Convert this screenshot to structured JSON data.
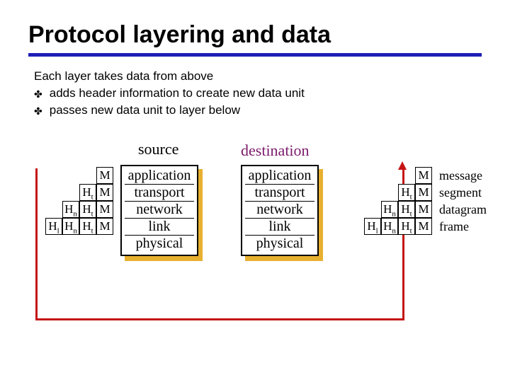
{
  "title": "Protocol layering and data",
  "intro": "Each layer takes data from above",
  "bullets": [
    "adds header information to create new data unit",
    "passes new data unit to layer below"
  ],
  "stack_labels": {
    "source": "source",
    "destination": "destination"
  },
  "layers": [
    "application",
    "transport",
    "network",
    "link",
    "physical"
  ],
  "headers": {
    "Ht": "Ht",
    "Hn": "Hn",
    "Hl": "Hl",
    "M": "M"
  },
  "data_unit_names": [
    "message",
    "segment",
    "datagram",
    "frame"
  ]
}
